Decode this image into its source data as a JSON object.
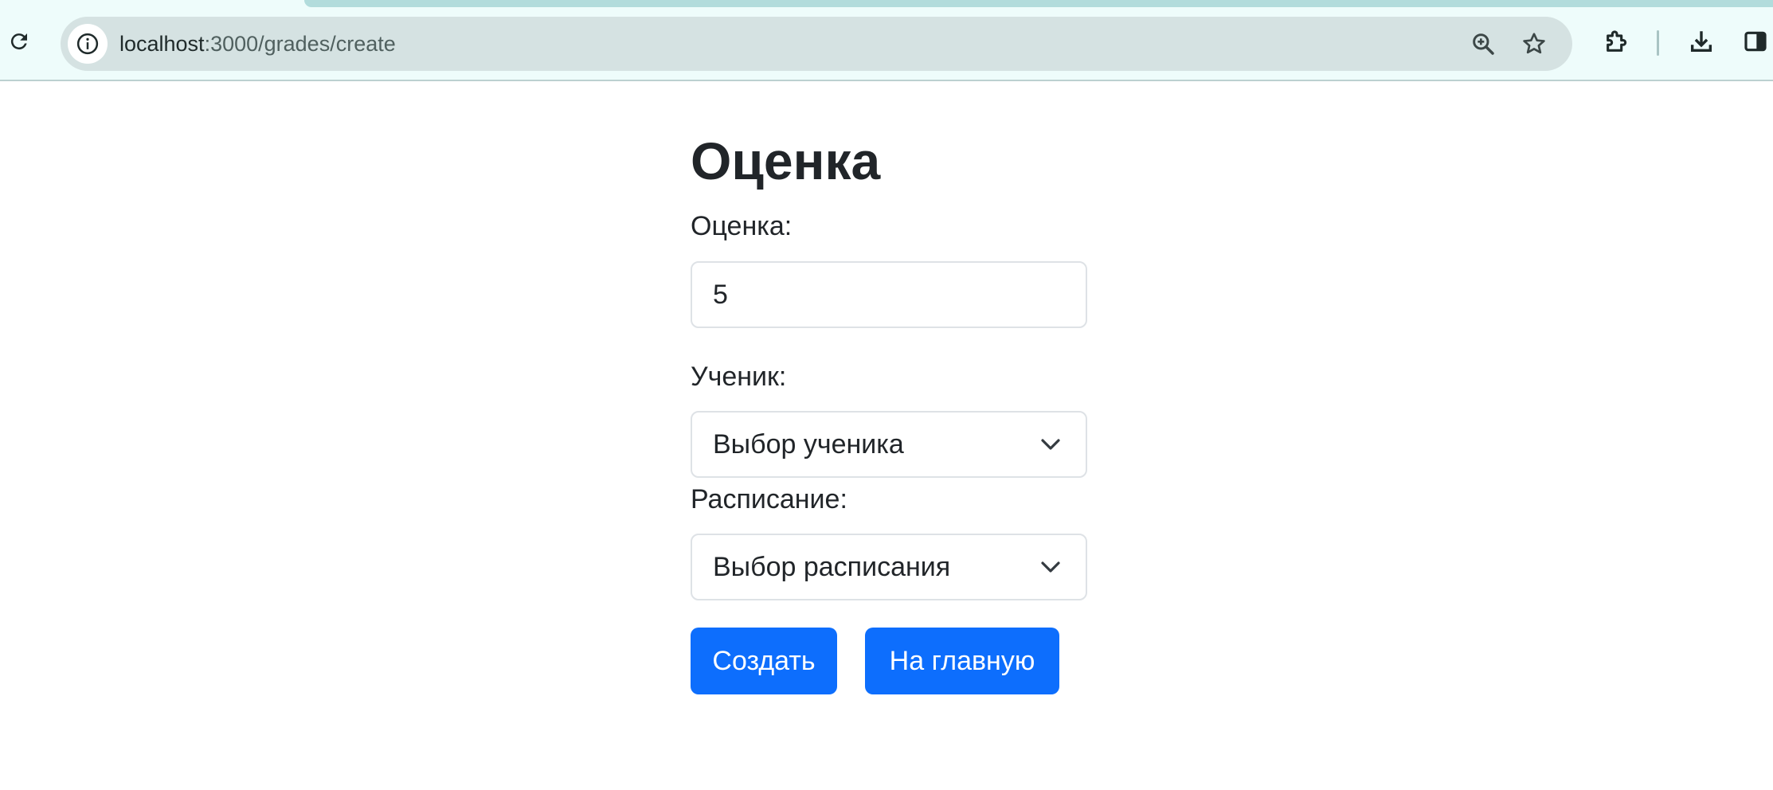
{
  "browser": {
    "url_host": "localhost",
    "url_path": ":3000/grades/create",
    "icons": {
      "reload": "reload-icon",
      "site_info": "info-icon",
      "zoom": "zoom-icon",
      "bookmark": "star-icon",
      "extensions": "puzzle-icon",
      "downloads": "download-icon",
      "side_panel": "side-panel-icon"
    }
  },
  "page": {
    "title": "Оценка",
    "grade_label": "Оценка:",
    "grade_value": "5",
    "student_label": "Ученик:",
    "student_select_value": "Выбор ученика",
    "schedule_label": "Расписание:",
    "schedule_select_value": "Выбор расписания",
    "create_button": "Создать",
    "home_button": "На главную"
  },
  "colors": {
    "primary": "#0d6efd",
    "chrome_bg": "#eefcfb",
    "omnibox_bg": "#d5e2e2",
    "text": "#212529",
    "input_border": "#dee2e6"
  }
}
